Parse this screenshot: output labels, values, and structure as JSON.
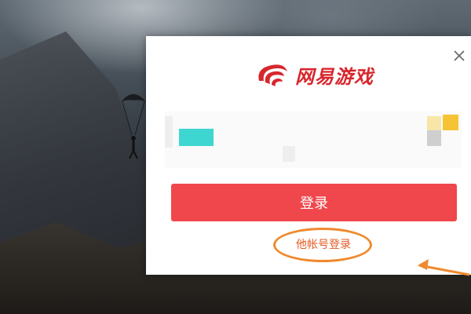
{
  "dialog": {
    "brand_name": "网易游戏",
    "login_button_label": "登录",
    "other_account_login_label": "他帐号登录",
    "close_icon": "close-icon"
  },
  "colors": {
    "brand_red": "#d8262d",
    "login_button_bg": "#f0474c",
    "highlight_orange": "#ef8a2e",
    "link_orange": "#e55a22"
  },
  "icons": [
    "netease-logo-icon",
    "close-icon",
    "qr-code-icon",
    "parachute-icon"
  ]
}
